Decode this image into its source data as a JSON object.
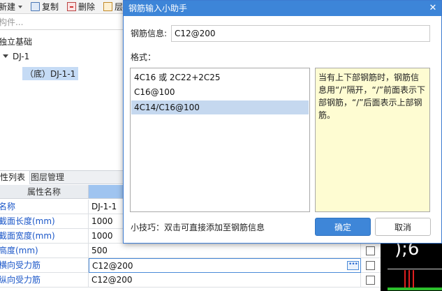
{
  "toolbar": {
    "new_label": "新建",
    "copy_label": "复制",
    "delete_label": "删除",
    "layer_label": "层"
  },
  "search": {
    "placeholder": "构件..."
  },
  "tree": {
    "root_label": "独立基础",
    "group_label": "DJ-1",
    "selected_label": "（底）DJ-1-1"
  },
  "props": {
    "tab_attributes": "性列表",
    "tab_layers": "图层管理",
    "header_name": "属性名称",
    "rows": [
      {
        "name": "名称",
        "value": "DJ-1-1"
      },
      {
        "name": "截面长度(mm)",
        "value": "1000"
      },
      {
        "name": "截面宽度(mm)",
        "value": "1000"
      },
      {
        "name": "高度(mm)",
        "value": "500"
      },
      {
        "name": "横向受力筋",
        "value": "C12@200"
      },
      {
        "name": "纵向受力筋",
        "value": "C12@200"
      }
    ]
  },
  "cad": {
    "text": ");6"
  },
  "dialog": {
    "title": "钢筋输入小助手",
    "info_label": "钢筋信息:",
    "info_value": "C12@200",
    "format_label": "格式：",
    "formats": [
      "4C16 或 2C22+2C25",
      "C16@100",
      "4C14/C16@100"
    ],
    "hint": "当有上下部钢筋时，钢筋信息用“/”隔开，“/”前面表示下部钢筋，“/”后面表示上部钢筋。",
    "tip": "小技巧：双击可直接添加至钢筋信息",
    "ok_label": "确定",
    "cancel_label": "取消"
  },
  "colors": {
    "accent": "#3d85d8",
    "hint_bg": "#fefcd2",
    "selected_row": "#c5d8ef",
    "link_text": "#1a56c8"
  }
}
